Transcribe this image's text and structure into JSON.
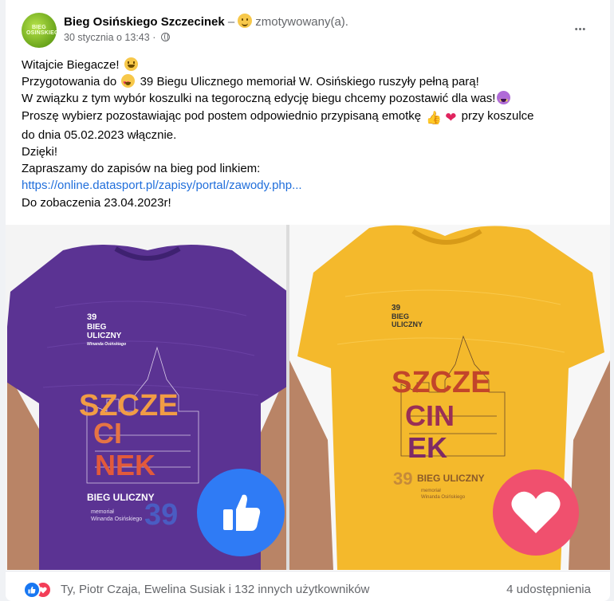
{
  "post": {
    "author": {
      "avatar_text": "BIEG OSIŃSKIEGO",
      "name": "Bieg Osińskiego Szczecinek",
      "separator": "–",
      "feeling": "zmotywowany(a)."
    },
    "timestamp": "30 stycznia o 13:43",
    "dot": "·",
    "more_label": "•••",
    "text": {
      "greeting": "Witajcie Biegacze!",
      "l2_a": "Przygotowania do",
      "l2_b": "39 Biegu Ulicznego memoriał W. Osińskiego ruszyły pełną parą!",
      "l3": "W związku z tym wybór koszulki na tegoroczną edycję biegu chcemy pozostawić dla was!",
      "l4_a": "Proszę wybierz pozostawiając pod postem odpowiednio przypisaną emotkę",
      "l4_b": "przy koszulce",
      "l5": "do dnia 05.02.2023 włącznie.",
      "l6": "Dzięki!",
      "l7": "Zapraszamy do zapisów na bieg pod linkiem:",
      "link": "https://online.datasport.pl/zapisy/portal/zawody.php...",
      "l9": "Do zobaczenia 23.04.2023r!"
    },
    "shirt_text": {
      "logo_number": "39",
      "logo_line1": "BIEG",
      "logo_line2": "ULICZNY",
      "logo_sub": "Winanda Osińskiego",
      "big1": "SZCZE",
      "big2": "CI",
      "big3": "NEK",
      "yellow_big1": "SZCZE",
      "yellow_big2": "CIN",
      "yellow_big3": "EK",
      "purple_bottom_title": "BIEG ULICZNY",
      "purple_bottom_memorial": "memoriał",
      "purple_bottom_name": "Winanda Osińskiego",
      "purple_bottom_number": "39",
      "yellow_bottom_number": "39",
      "yellow_bottom_title": "BIEG ULICZNY",
      "yellow_bottom_memorial": "memoriał",
      "yellow_bottom_name": "Winanda Osińskiego"
    },
    "reactions": {
      "summary": "Ty, Piotr Czaja, Ewelina Susiak i 132 innych użytkowników",
      "shares": "4 udostępnienia"
    }
  },
  "colors": {
    "purple_shirt": "#5b3393",
    "yellow_shirt": "#f4b92c",
    "like_blue": "#2f7bf5",
    "love_red": "#f0506e",
    "link_blue": "#216fdb"
  }
}
